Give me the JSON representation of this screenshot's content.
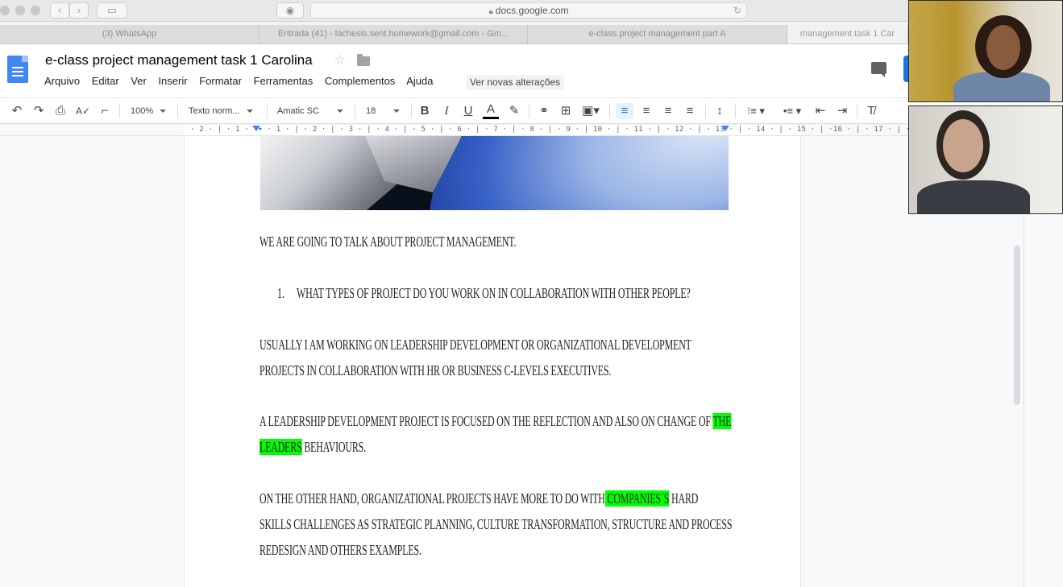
{
  "browser": {
    "url": "docs.google.com",
    "tabs": [
      "(3) WhatsApp",
      "Entrada (41) - lachesis.sent.homework@gmail.com - Gm...",
      "e-class project management part A",
      "management task 1 Car"
    ]
  },
  "docs": {
    "title": "e-class project management task 1 Carolina",
    "menu": [
      "Arquivo",
      "Editar",
      "Ver",
      "Inserir",
      "Formatar",
      "Ferramentas",
      "Complementos",
      "Ajuda"
    ],
    "changes_link": "Ver novas alterações",
    "toolbar": {
      "zoom": "100%",
      "style": "Texto norm...",
      "font": "Amatic SC",
      "size": "18",
      "bold": "B",
      "italic": "I",
      "underline": "U",
      "text_color": "A"
    },
    "ruler": "· 2 · | · 1 ·  ▾ · 1 · | · 2 · | · 3 · | · 4 · | · 5 · | · 6 · | · 7 · | · 8 · | · 9 · | 10 · | · 11 · | · 12 · | · 13 · | · 14 · | · 15 · | ·16 · | · 17 · | · 18",
    "content": {
      "p1": "We are going to talk about project management.",
      "q1_num": "1.",
      "q1": "What types of project do you work on in collaboration with other people?",
      "p2a": "Usually I am working on leadership development or organizational development",
      "p2b": "projects in collaboration with HR or business C-levels executives.",
      "p3a_pre": "A leadership development project is focused on the reflection and also on change of ",
      "p3a_hl": "the",
      "p3b_hl": "leaders",
      "p3b_post": " behaviours.",
      "p4a_pre": "On the other hand, organizational projects have more to do with",
      "p4a_hl": " companies´s",
      "p4a_post": " hard",
      "p4b": "skills challenges as strategic planning, culture transformation, structure and process",
      "p4c": "redesign and others examples."
    }
  },
  "colors": {
    "highlight": "#00ff00",
    "docs_blue": "#4285f4",
    "accent": "#1a73e8"
  }
}
